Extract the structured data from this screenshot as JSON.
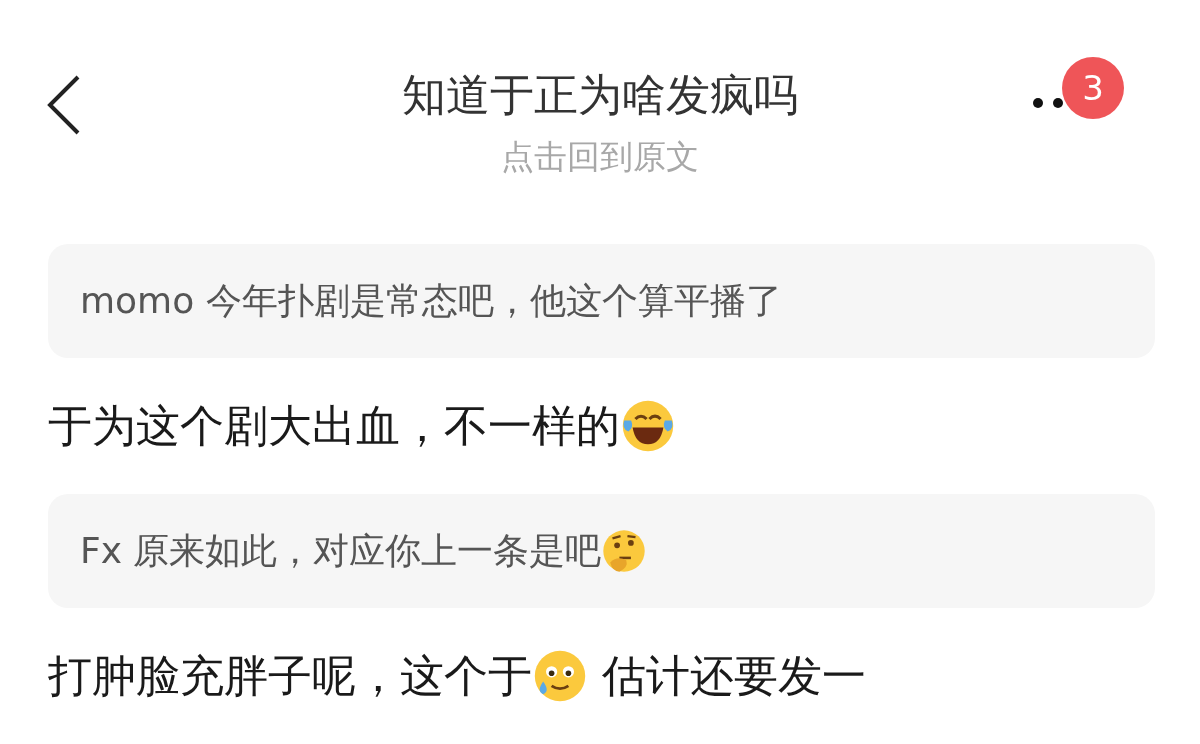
{
  "header": {
    "title": "知道于正为啥发疯吗",
    "subtitle": "点击回到原文",
    "badge": "3"
  },
  "posts": [
    {
      "kind": "quote",
      "text": "momo 今年扑剧是常态吧，他这个算平播了"
    },
    {
      "kind": "comment",
      "text": "于为这个剧大出血，不一样的",
      "emoji": {
        "kind": "laugh-cry"
      }
    },
    {
      "kind": "quote",
      "text": "Fx 原来如此，对应你上一条是吧",
      "emoji": {
        "kind": "thinking"
      }
    },
    {
      "kind": "comment",
      "text": "打肿脸充胖子呢，这个于",
      "emoji": {
        "kind": "sweat-smile"
      },
      "after": "估计还要发一"
    }
  ]
}
